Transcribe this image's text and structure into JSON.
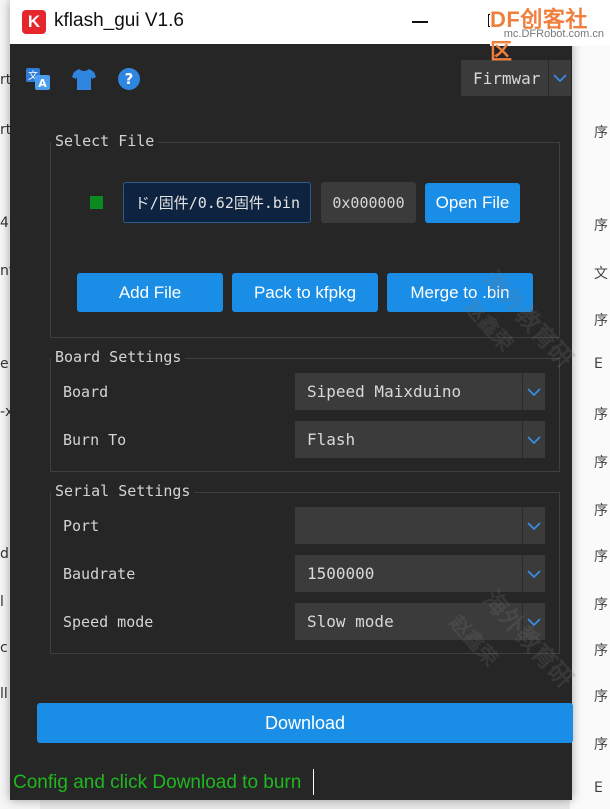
{
  "window": {
    "title": "kflash_gui V1.6",
    "app_icon_letter": "K"
  },
  "watermark": {
    "brand": "DF创客社区",
    "site": "mc.DFRobot.com.cn",
    "overlay_lines": [
      "海外教育研",
      "赵鑫荣"
    ]
  },
  "toolbar": {
    "language_icon": "translate-icon",
    "skin_icon": "shirt-icon",
    "help_icon": "help-icon",
    "mode_select": {
      "value": "Firmwar"
    }
  },
  "select_file": {
    "title": "Select File",
    "file_path": "ド/固件/0.62固件.bin",
    "address": "0x000000",
    "open_file_label": "Open File",
    "add_file_label": "Add File",
    "pack_label": "Pack to kfpkg",
    "merge_label": "Merge to .bin"
  },
  "board_settings": {
    "title": "Board Settings",
    "board_label": "Board",
    "board_value": "Sipeed Maixduino",
    "burn_to_label": "Burn To",
    "burn_to_value": "Flash"
  },
  "serial_settings": {
    "title": "Serial Settings",
    "port_label": "Port",
    "port_value": "",
    "baudrate_label": "Baudrate",
    "baudrate_value": "1500000",
    "speed_label": "Speed mode",
    "speed_value": "Slow mode"
  },
  "download_label": "Download",
  "status_text": "Config and click Download to burn",
  "background_fragments": {
    "left": [
      "rt",
      "rt",
      "4",
      "nf",
      "e.n",
      "-x",
      "d",
      "l",
      "c",
      "ll"
    ],
    "right": [
      "序",
      "序",
      "文",
      "序",
      "E",
      "序",
      "序",
      "序",
      "序",
      "序",
      "序",
      "序",
      "序",
      "E"
    ]
  },
  "colors": {
    "window_bg": "#262626",
    "accent": "#1a8ee6",
    "status_text": "#1fb81f",
    "enable_box": "#0c8a22",
    "title_icon": "#e5262d"
  }
}
